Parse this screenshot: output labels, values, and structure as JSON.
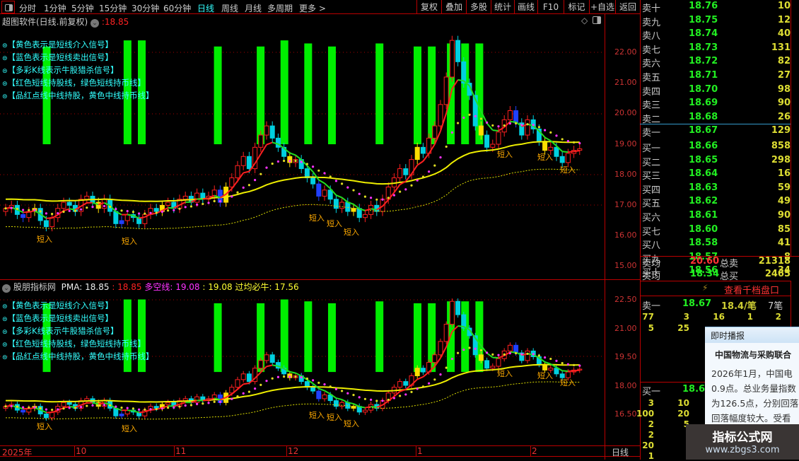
{
  "toolbar": {
    "periods": [
      "分时",
      "1分钟",
      "5分钟",
      "15分钟",
      "30分钟",
      "60分钟",
      "日线",
      "周线",
      "月线",
      "多周期",
      "更多 >"
    ],
    "active": "日线",
    "buttons": [
      "复权",
      "叠加",
      "多股",
      "统计",
      "画线",
      "F10",
      "标记",
      "+自选",
      "返回"
    ]
  },
  "main_panel": {
    "title": "超图软件(日线.前复权)",
    "price_value": ":18.85",
    "price_color": "#ff2020",
    "legend": [
      "【黄色表示是短线介入信号】",
      "【蓝色表示是短线卖出信号】",
      "【多彩K线表示牛股猎杀信号】",
      "【红色短线持股线，绿色短线持币线】",
      "【品红点线中线持股，黄色中线持币线】"
    ],
    "price_axis": [
      "22.00",
      "21.00",
      "20.00",
      "19.00",
      "18.00",
      "17.00",
      "16.00",
      "15.00"
    ],
    "signal_label": "短入"
  },
  "sub_panel": {
    "title": "股朋指标网",
    "pma_label": "PMA: 18.85",
    "pma_value": ": 18.85",
    "dk_label": "多空线: 19.08",
    "dk_value": ": 19.08",
    "gj_label": "过均必牛: 17.56",
    "price_axis": [
      "22.50",
      "21.00",
      "19.50",
      "18.00",
      "16.50"
    ]
  },
  "date_axis": {
    "labels": [
      "2025年",
      "10",
      "11",
      "12",
      "1",
      "2"
    ],
    "period": "日线"
  },
  "chart_data": {
    "type": "candlestick",
    "closes": [
      16.9,
      17.0,
      16.7,
      16.6,
      16.8,
      16.9,
      16.5,
      16.3,
      16.6,
      16.9,
      17.1,
      17.0,
      16.8,
      17.2,
      17.3,
      17.1,
      16.9,
      17.2,
      16.8,
      16.4,
      16.5,
      16.7,
      16.6,
      16.4,
      16.7,
      16.9,
      16.8,
      17.0,
      17.1,
      16.9,
      17.2,
      17.3,
      17.1,
      17.4,
      17.2,
      17.3,
      17.5,
      17.1,
      17.6,
      17.9,
      18.3,
      18.6,
      18.2,
      18.9,
      19.3,
      19.6,
      19.2,
      18.9,
      18.6,
      18.4,
      18.5,
      18.2,
      17.9,
      17.7,
      17.3,
      17.5,
      17.2,
      16.9,
      17.1,
      16.8,
      16.9,
      16.6,
      16.7,
      17.0,
      16.8,
      17.2,
      17.6,
      17.9,
      18.2,
      18.0,
      18.5,
      18.9,
      18.7,
      19.2,
      19.6,
      20.3,
      21.2,
      22.4,
      21.7,
      21.0,
      20.6,
      19.6,
      19.3,
      18.9,
      19.0,
      19.4,
      19.8,
      20.1,
      19.7,
      19.3,
      19.8,
      19.5,
      19.1,
      18.8,
      18.9,
      18.6,
      18.4,
      18.7,
      18.8,
      18.85
    ],
    "signal_bars": [
      9,
      26,
      29,
      45,
      54,
      59,
      64,
      69,
      79,
      87,
      90,
      94,
      97,
      100
    ],
    "series": [
      {
        "name": "PMA",
        "color": "#ff2020"
      },
      {
        "name": "多空线",
        "color": "#ff33ff"
      },
      {
        "name": "过均必牛",
        "color": "#ffff33"
      }
    ]
  },
  "order_book": {
    "asks": [
      [
        "卖十",
        "18.76",
        "10"
      ],
      [
        "卖九",
        "18.75",
        "12"
      ],
      [
        "卖八",
        "18.74",
        "40"
      ],
      [
        "卖七",
        "18.73",
        "131"
      ],
      [
        "卖六",
        "18.72",
        "82"
      ],
      [
        "卖五",
        "18.71",
        "27"
      ],
      [
        "卖四",
        "18.70",
        "98"
      ],
      [
        "卖三",
        "18.69",
        "90"
      ],
      [
        "卖二",
        "18.68",
        "26"
      ],
      [
        "卖一",
        "18.67",
        "129"
      ]
    ],
    "bids": [
      [
        "买一",
        "18.66",
        "858"
      ],
      [
        "买二",
        "18.65",
        "298"
      ],
      [
        "买三",
        "18.64",
        "16"
      ],
      [
        "买四",
        "18.63",
        "59"
      ],
      [
        "买五",
        "18.62",
        "49"
      ],
      [
        "买六",
        "18.61",
        "90"
      ],
      [
        "买七",
        "18.60",
        "85"
      ],
      [
        "买八",
        "18.58",
        "41"
      ],
      [
        "买九",
        "18.57",
        "8"
      ],
      [
        "买十",
        "18.56",
        "34"
      ]
    ],
    "avg_sell_label": "卖均",
    "avg_sell": "20.60",
    "total_sell_label": "总卖",
    "total_sell": "21318",
    "avg_buy_label": "买均",
    "avg_buy": "18.34",
    "total_buy_label": "总买",
    "total_buy": "2465",
    "depth_link": "查看千档盘口",
    "sell1": {
      "label": "卖一",
      "price": "18.67",
      "avg": "18.4/笔",
      "count": "7笔",
      "ticks": [
        [
          "77",
          "3",
          "16",
          "1",
          "2"
        ],
        [
          "5",
          "25"
        ]
      ]
    },
    "buy1": {
      "label": "买一",
      "price": "18.66",
      "ticks": [
        [
          "3",
          "10"
        ],
        [
          "100",
          "20"
        ],
        [
          "2",
          "5"
        ],
        [
          "2",
          ""
        ],
        [
          "20",
          ""
        ],
        [
          "1",
          ""
        ]
      ]
    }
  },
  "popup": {
    "title": "即时播报",
    "headline": "中国物流与采购联合",
    "body": "2026年1月，中国电 0.9点。总业务量指数 为126.5点，分别回落 回落幅度较大。受看"
  },
  "watermark": {
    "name": "指标公式网",
    "url": "www.zbgs3.com"
  }
}
